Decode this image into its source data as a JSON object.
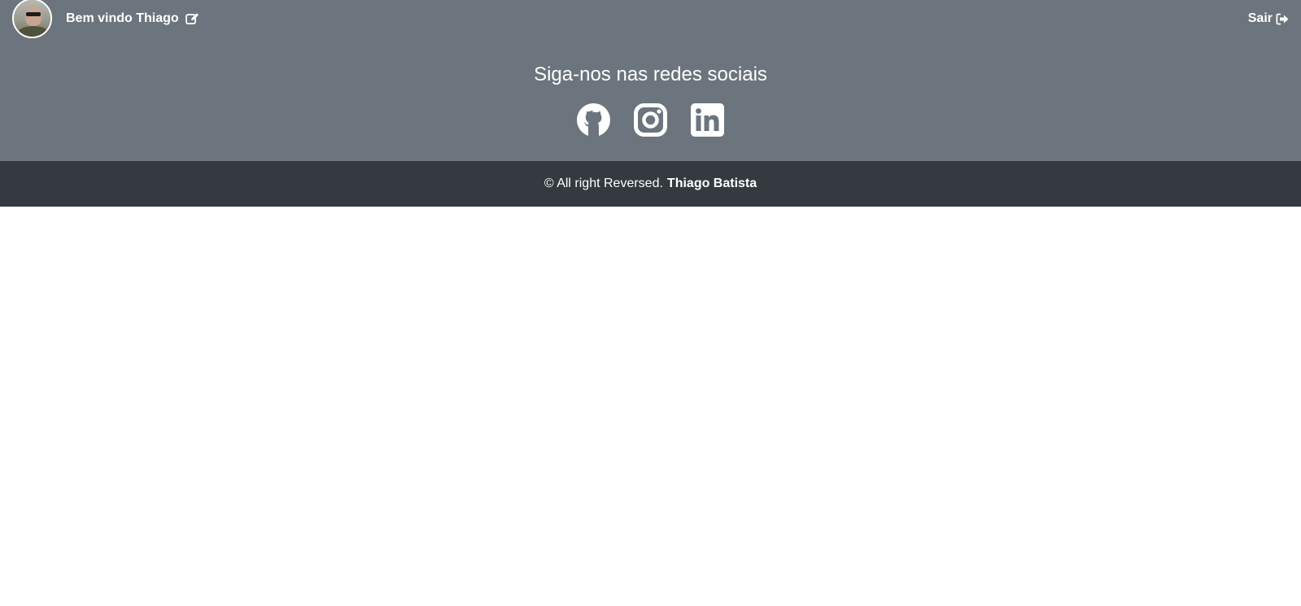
{
  "header": {
    "welcome_text": "Bem vindo Thiago",
    "logout_label": "Sair"
  },
  "social": {
    "title": "Siga-nos nas redes sociais",
    "links": [
      {
        "icon": "github-icon"
      },
      {
        "icon": "instagram-icon"
      },
      {
        "icon": "linkedin-icon"
      }
    ]
  },
  "footer": {
    "copyright_text": "© All right Reversed.",
    "author": "Thiago Batista"
  },
  "colors": {
    "header_bg": "#6c757d",
    "footer_bg": "#343a40",
    "text": "#ffffff",
    "page_bg": "#ffffff"
  }
}
